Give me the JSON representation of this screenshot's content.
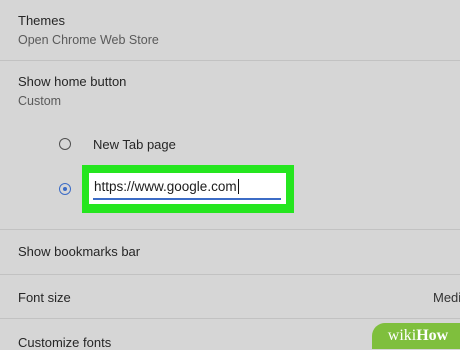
{
  "themes": {
    "label": "Themes",
    "value": "Open Chrome Web Store"
  },
  "home_button": {
    "label": "Show home button",
    "value": "Custom",
    "options": {
      "new_tab": "New Tab page",
      "custom_url": "https://www.google.com"
    },
    "selected": "custom_url"
  },
  "bookmarks_bar": {
    "label": "Show bookmarks bar"
  },
  "font_size": {
    "label": "Font size",
    "value": "Medi"
  },
  "customize_fonts": {
    "label": "Customize fonts"
  },
  "watermark": {
    "prefix": "wiki",
    "suffix": "How"
  },
  "colors": {
    "highlight": "#25e61f",
    "accent": "#3c6cc6",
    "background": "#d6d6d6"
  }
}
